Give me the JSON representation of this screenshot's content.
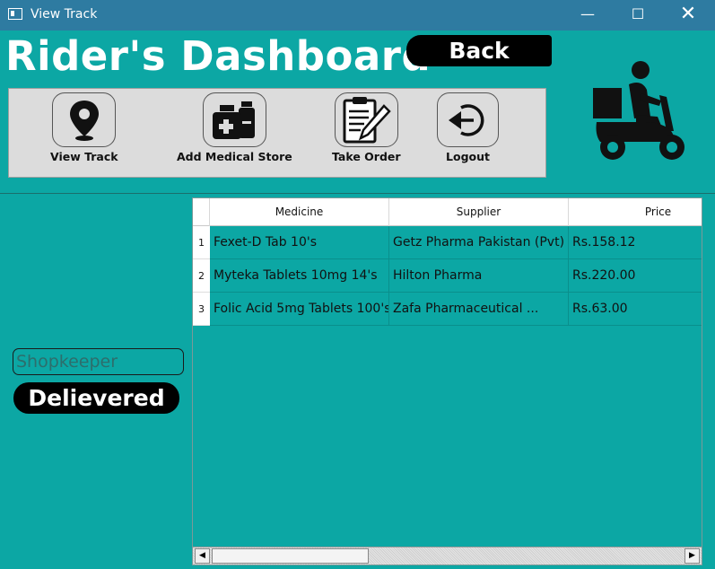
{
  "window": {
    "title": "View Track",
    "minimize_glyph": "—",
    "maximize_glyph": "☐",
    "close_glyph": "✕"
  },
  "header": {
    "title": "Rider's Dashboard",
    "back_label": "Back"
  },
  "toolbar": {
    "items": [
      {
        "label": "View Track",
        "icon": "map-pin-icon"
      },
      {
        "label": "Add Medical Store",
        "icon": "medicine-bottles-icon"
      },
      {
        "label": "Take Order",
        "icon": "clipboard-pen-icon"
      },
      {
        "label": "Logout",
        "icon": "logout-arrow-icon"
      }
    ]
  },
  "side": {
    "shopkeeper_placeholder": "Shopkeeper",
    "delivered_label": "Delievered"
  },
  "table": {
    "columns": [
      "Medicine",
      "Supplier",
      "Price"
    ],
    "rows": [
      {
        "num": "1",
        "medicine": "Fexet-D Tab 10's",
        "supplier": "Getz Pharma Pakistan (Pvt) ...",
        "price": "Rs.158.12"
      },
      {
        "num": "2",
        "medicine": "Myteka Tablets 10mg 14's",
        "supplier": "Hilton Pharma",
        "price": "Rs.220.00"
      },
      {
        "num": "3",
        "medicine": "Folic Acid 5mg Tablets 100's",
        "supplier": "Zafa Pharmaceutical ...",
        "price": "Rs.63.00"
      }
    ],
    "scroll_left_glyph": "◀",
    "scroll_right_glyph": "▶"
  },
  "colors": {
    "background": "#0ca7a4",
    "titlebar": "#2e7ba1",
    "button": "#000000"
  }
}
